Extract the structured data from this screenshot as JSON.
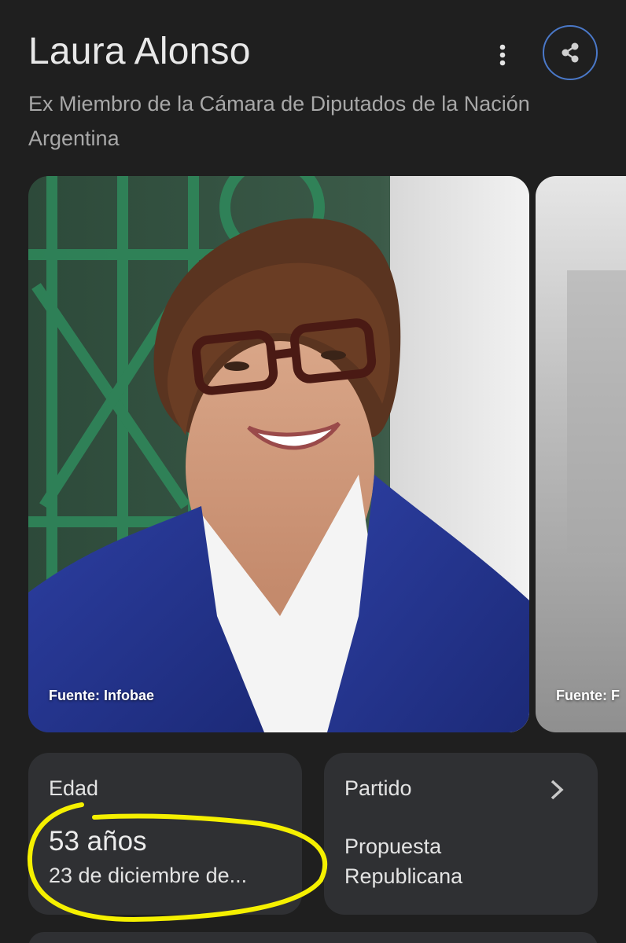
{
  "header": {
    "title": "Laura Alonso",
    "subtitle": "Ex Miembro de la Cámara de Diputados de la Nación Argentina",
    "more_icon": "more-vert-icon",
    "share_icon": "share-icon"
  },
  "images": [
    {
      "source": "Fuente: Infobae"
    },
    {
      "source": "Fuente: F"
    }
  ],
  "cards": {
    "age": {
      "label": "Edad",
      "value": "53 años",
      "detail": "23 de diciembre de..."
    },
    "party": {
      "label": "Partido",
      "value": "Propuesta Republicana",
      "icon": "chevron-right-icon"
    }
  },
  "colors": {
    "background": "#1f1f1f",
    "card": "#2f3033",
    "share_border": "#4a78c8",
    "annotation": "#f5f000"
  }
}
